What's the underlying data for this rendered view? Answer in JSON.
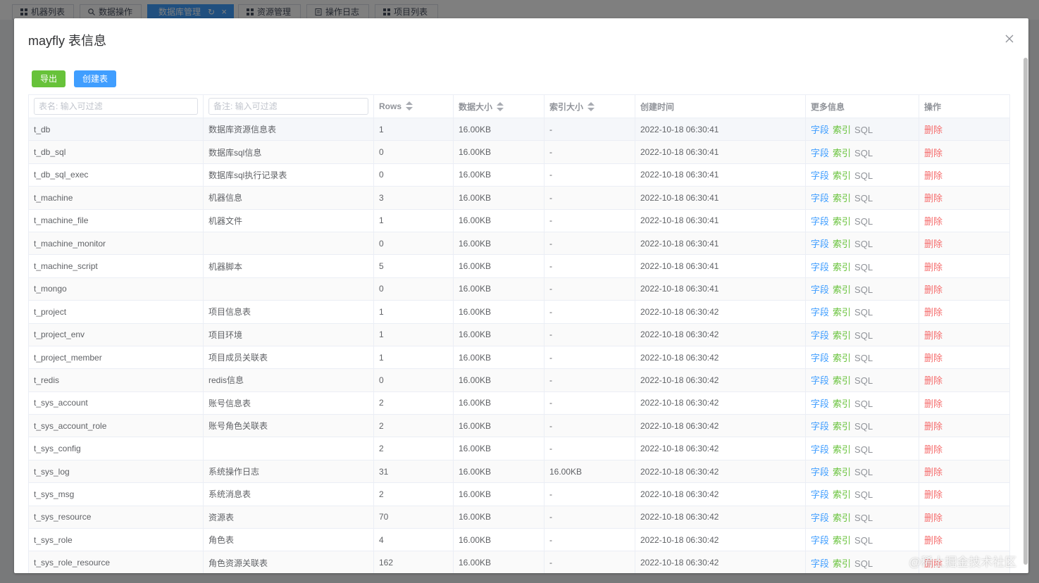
{
  "tabs": [
    {
      "label": "机器列表",
      "icon": "grid-icon"
    },
    {
      "label": "数据操作",
      "icon": "search-icon"
    },
    {
      "label": "数据库管理",
      "icon": "",
      "active": true
    },
    {
      "label": "资源管理",
      "icon": "grid-icon"
    },
    {
      "label": "操作日志",
      "icon": "document-icon"
    },
    {
      "label": "项目列表",
      "icon": "grid-icon"
    }
  ],
  "dialog": {
    "title": "mayfly 表信息",
    "export_label": "导出",
    "create_label": "创建表"
  },
  "table": {
    "filters": {
      "name_placeholder": "表名: 输入可过滤",
      "comment_placeholder": "备注: 输入可过滤"
    },
    "headers": {
      "rows": "Rows",
      "data_size": "数据大小",
      "index_size": "索引大小",
      "create_time": "创建时间",
      "more_info": "更多信息",
      "actions": "操作"
    },
    "link_labels": {
      "field": "字段",
      "index": "索引",
      "sql": "SQL",
      "delete": "删除"
    },
    "rows": [
      {
        "name": "t_db",
        "comment": "数据库资源信息表",
        "rows": "1",
        "data_size": "16.00KB",
        "index_size": "-",
        "create_time": "2022-10-18 06:30:41"
      },
      {
        "name": "t_db_sql",
        "comment": "数据库sql信息",
        "rows": "0",
        "data_size": "16.00KB",
        "index_size": "-",
        "create_time": "2022-10-18 06:30:41"
      },
      {
        "name": "t_db_sql_exec",
        "comment": "数据库sql执行记录表",
        "rows": "0",
        "data_size": "16.00KB",
        "index_size": "-",
        "create_time": "2022-10-18 06:30:41"
      },
      {
        "name": "t_machine",
        "comment": "机器信息",
        "rows": "3",
        "data_size": "16.00KB",
        "index_size": "-",
        "create_time": "2022-10-18 06:30:41"
      },
      {
        "name": "t_machine_file",
        "comment": "机器文件",
        "rows": "1",
        "data_size": "16.00KB",
        "index_size": "-",
        "create_time": "2022-10-18 06:30:41"
      },
      {
        "name": "t_machine_monitor",
        "comment": "",
        "rows": "0",
        "data_size": "16.00KB",
        "index_size": "-",
        "create_time": "2022-10-18 06:30:41"
      },
      {
        "name": "t_machine_script",
        "comment": "机器脚本",
        "rows": "5",
        "data_size": "16.00KB",
        "index_size": "-",
        "create_time": "2022-10-18 06:30:41"
      },
      {
        "name": "t_mongo",
        "comment": "",
        "rows": "0",
        "data_size": "16.00KB",
        "index_size": "-",
        "create_time": "2022-10-18 06:30:41"
      },
      {
        "name": "t_project",
        "comment": "项目信息表",
        "rows": "1",
        "data_size": "16.00KB",
        "index_size": "-",
        "create_time": "2022-10-18 06:30:42"
      },
      {
        "name": "t_project_env",
        "comment": "项目环境",
        "rows": "1",
        "data_size": "16.00KB",
        "index_size": "-",
        "create_time": "2022-10-18 06:30:42"
      },
      {
        "name": "t_project_member",
        "comment": "项目成员关联表",
        "rows": "1",
        "data_size": "16.00KB",
        "index_size": "-",
        "create_time": "2022-10-18 06:30:42"
      },
      {
        "name": "t_redis",
        "comment": "redis信息",
        "rows": "0",
        "data_size": "16.00KB",
        "index_size": "-",
        "create_time": "2022-10-18 06:30:42"
      },
      {
        "name": "t_sys_account",
        "comment": "账号信息表",
        "rows": "2",
        "data_size": "16.00KB",
        "index_size": "-",
        "create_time": "2022-10-18 06:30:42"
      },
      {
        "name": "t_sys_account_role",
        "comment": "账号角色关联表",
        "rows": "2",
        "data_size": "16.00KB",
        "index_size": "-",
        "create_time": "2022-10-18 06:30:42"
      },
      {
        "name": "t_sys_config",
        "comment": "",
        "rows": "2",
        "data_size": "16.00KB",
        "index_size": "-",
        "create_time": "2022-10-18 06:30:42"
      },
      {
        "name": "t_sys_log",
        "comment": "系统操作日志",
        "rows": "31",
        "data_size": "16.00KB",
        "index_size": "16.00KB",
        "create_time": "2022-10-18 06:30:42"
      },
      {
        "name": "t_sys_msg",
        "comment": "系统消息表",
        "rows": "2",
        "data_size": "16.00KB",
        "index_size": "-",
        "create_time": "2022-10-18 06:30:42"
      },
      {
        "name": "t_sys_resource",
        "comment": "资源表",
        "rows": "70",
        "data_size": "16.00KB",
        "index_size": "-",
        "create_time": "2022-10-18 06:30:42"
      },
      {
        "name": "t_sys_role",
        "comment": "角色表",
        "rows": "4",
        "data_size": "16.00KB",
        "index_size": "-",
        "create_time": "2022-10-18 06:30:42"
      },
      {
        "name": "t_sys_role_resource",
        "comment": "角色资源关联表",
        "rows": "162",
        "data_size": "16.00KB",
        "index_size": "-",
        "create_time": "2022-10-18 06:30:42"
      }
    ]
  },
  "watermark": "@稀土掘金技术社区",
  "colors": {
    "primary": "#409eff",
    "success": "#67c23a",
    "danger": "#f56c6c",
    "info": "#909399"
  }
}
